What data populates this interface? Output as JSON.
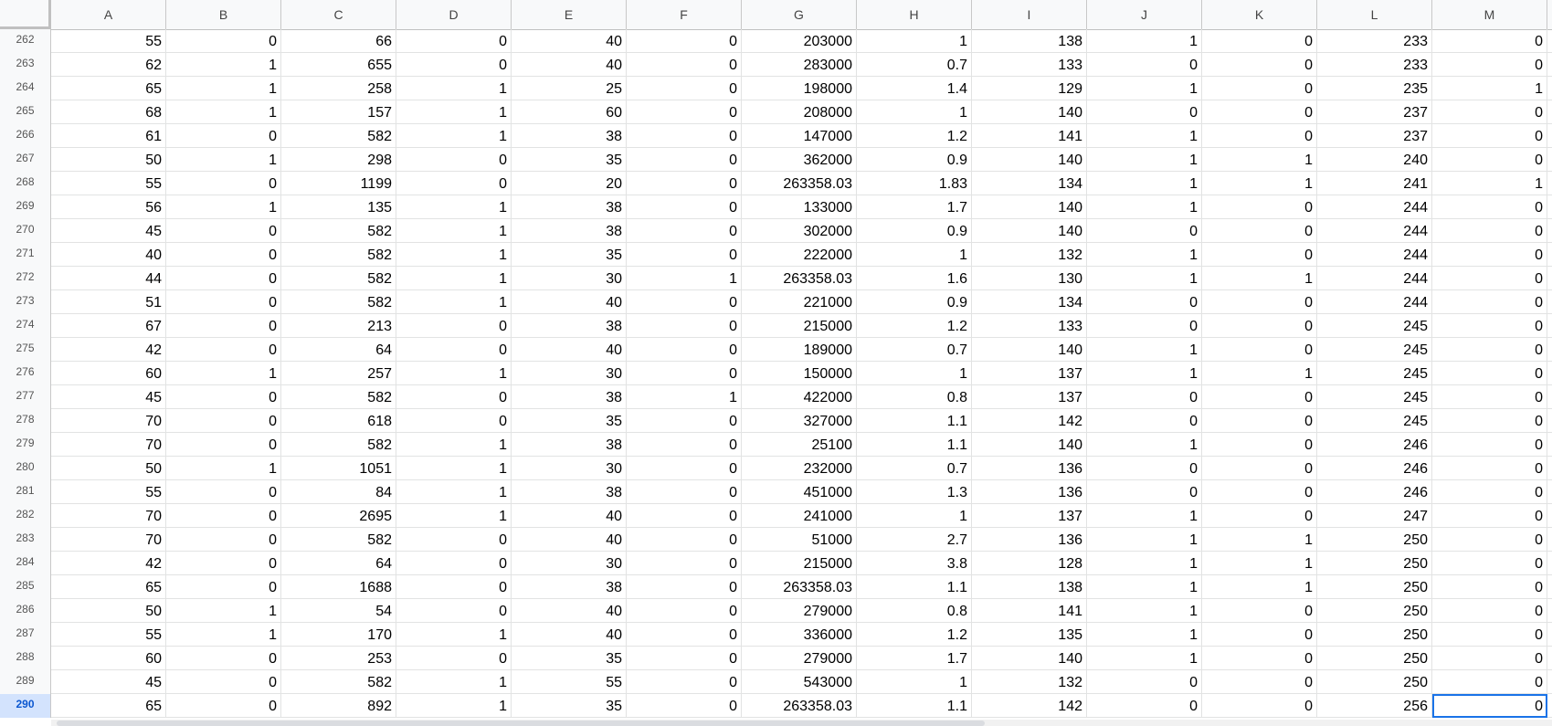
{
  "columns": [
    "A",
    "B",
    "C",
    "D",
    "E",
    "F",
    "G",
    "H",
    "I",
    "J",
    "K",
    "L",
    "M"
  ],
  "active_row": "290",
  "selected_cell": "M290",
  "rows": [
    {
      "num": "262",
      "cells": [
        "55",
        "0",
        "66",
        "0",
        "40",
        "0",
        "203000",
        "1",
        "138",
        "1",
        "0",
        "233",
        "0"
      ]
    },
    {
      "num": "263",
      "cells": [
        "62",
        "1",
        "655",
        "0",
        "40",
        "0",
        "283000",
        "0.7",
        "133",
        "0",
        "0",
        "233",
        "0"
      ]
    },
    {
      "num": "264",
      "cells": [
        "65",
        "1",
        "258",
        "1",
        "25",
        "0",
        "198000",
        "1.4",
        "129",
        "1",
        "0",
        "235",
        "1"
      ]
    },
    {
      "num": "265",
      "cells": [
        "68",
        "1",
        "157",
        "1",
        "60",
        "0",
        "208000",
        "1",
        "140",
        "0",
        "0",
        "237",
        "0"
      ]
    },
    {
      "num": "266",
      "cells": [
        "61",
        "0",
        "582",
        "1",
        "38",
        "0",
        "147000",
        "1.2",
        "141",
        "1",
        "0",
        "237",
        "0"
      ]
    },
    {
      "num": "267",
      "cells": [
        "50",
        "1",
        "298",
        "0",
        "35",
        "0",
        "362000",
        "0.9",
        "140",
        "1",
        "1",
        "240",
        "0"
      ]
    },
    {
      "num": "268",
      "cells": [
        "55",
        "0",
        "1199",
        "0",
        "20",
        "0",
        "263358.03",
        "1.83",
        "134",
        "1",
        "1",
        "241",
        "1"
      ]
    },
    {
      "num": "269",
      "cells": [
        "56",
        "1",
        "135",
        "1",
        "38",
        "0",
        "133000",
        "1.7",
        "140",
        "1",
        "0",
        "244",
        "0"
      ]
    },
    {
      "num": "270",
      "cells": [
        "45",
        "0",
        "582",
        "1",
        "38",
        "0",
        "302000",
        "0.9",
        "140",
        "0",
        "0",
        "244",
        "0"
      ]
    },
    {
      "num": "271",
      "cells": [
        "40",
        "0",
        "582",
        "1",
        "35",
        "0",
        "222000",
        "1",
        "132",
        "1",
        "0",
        "244",
        "0"
      ]
    },
    {
      "num": "272",
      "cells": [
        "44",
        "0",
        "582",
        "1",
        "30",
        "1",
        "263358.03",
        "1.6",
        "130",
        "1",
        "1",
        "244",
        "0"
      ]
    },
    {
      "num": "273",
      "cells": [
        "51",
        "0",
        "582",
        "1",
        "40",
        "0",
        "221000",
        "0.9",
        "134",
        "0",
        "0",
        "244",
        "0"
      ]
    },
    {
      "num": "274",
      "cells": [
        "67",
        "0",
        "213",
        "0",
        "38",
        "0",
        "215000",
        "1.2",
        "133",
        "0",
        "0",
        "245",
        "0"
      ]
    },
    {
      "num": "275",
      "cells": [
        "42",
        "0",
        "64",
        "0",
        "40",
        "0",
        "189000",
        "0.7",
        "140",
        "1",
        "0",
        "245",
        "0"
      ]
    },
    {
      "num": "276",
      "cells": [
        "60",
        "1",
        "257",
        "1",
        "30",
        "0",
        "150000",
        "1",
        "137",
        "1",
        "1",
        "245",
        "0"
      ]
    },
    {
      "num": "277",
      "cells": [
        "45",
        "0",
        "582",
        "0",
        "38",
        "1",
        "422000",
        "0.8",
        "137",
        "0",
        "0",
        "245",
        "0"
      ]
    },
    {
      "num": "278",
      "cells": [
        "70",
        "0",
        "618",
        "0",
        "35",
        "0",
        "327000",
        "1.1",
        "142",
        "0",
        "0",
        "245",
        "0"
      ]
    },
    {
      "num": "279",
      "cells": [
        "70",
        "0",
        "582",
        "1",
        "38",
        "0",
        "25100",
        "1.1",
        "140",
        "1",
        "0",
        "246",
        "0"
      ]
    },
    {
      "num": "280",
      "cells": [
        "50",
        "1",
        "1051",
        "1",
        "30",
        "0",
        "232000",
        "0.7",
        "136",
        "0",
        "0",
        "246",
        "0"
      ]
    },
    {
      "num": "281",
      "cells": [
        "55",
        "0",
        "84",
        "1",
        "38",
        "0",
        "451000",
        "1.3",
        "136",
        "0",
        "0",
        "246",
        "0"
      ]
    },
    {
      "num": "282",
      "cells": [
        "70",
        "0",
        "2695",
        "1",
        "40",
        "0",
        "241000",
        "1",
        "137",
        "1",
        "0",
        "247",
        "0"
      ]
    },
    {
      "num": "283",
      "cells": [
        "70",
        "0",
        "582",
        "0",
        "40",
        "0",
        "51000",
        "2.7",
        "136",
        "1",
        "1",
        "250",
        "0"
      ]
    },
    {
      "num": "284",
      "cells": [
        "42",
        "0",
        "64",
        "0",
        "30",
        "0",
        "215000",
        "3.8",
        "128",
        "1",
        "1",
        "250",
        "0"
      ]
    },
    {
      "num": "285",
      "cells": [
        "65",
        "0",
        "1688",
        "0",
        "38",
        "0",
        "263358.03",
        "1.1",
        "138",
        "1",
        "1",
        "250",
        "0"
      ]
    },
    {
      "num": "286",
      "cells": [
        "50",
        "1",
        "54",
        "0",
        "40",
        "0",
        "279000",
        "0.8",
        "141",
        "1",
        "0",
        "250",
        "0"
      ]
    },
    {
      "num": "287",
      "cells": [
        "55",
        "1",
        "170",
        "1",
        "40",
        "0",
        "336000",
        "1.2",
        "135",
        "1",
        "0",
        "250",
        "0"
      ]
    },
    {
      "num": "288",
      "cells": [
        "60",
        "0",
        "253",
        "0",
        "35",
        "0",
        "279000",
        "1.7",
        "140",
        "1",
        "0",
        "250",
        "0"
      ]
    },
    {
      "num": "289",
      "cells": [
        "45",
        "0",
        "582",
        "1",
        "55",
        "0",
        "543000",
        "1",
        "132",
        "0",
        "0",
        "250",
        "0"
      ]
    },
    {
      "num": "290",
      "cells": [
        "65",
        "0",
        "892",
        "1",
        "35",
        "0",
        "263358.03",
        "1.1",
        "142",
        "0",
        "0",
        "256",
        "0"
      ]
    }
  ]
}
